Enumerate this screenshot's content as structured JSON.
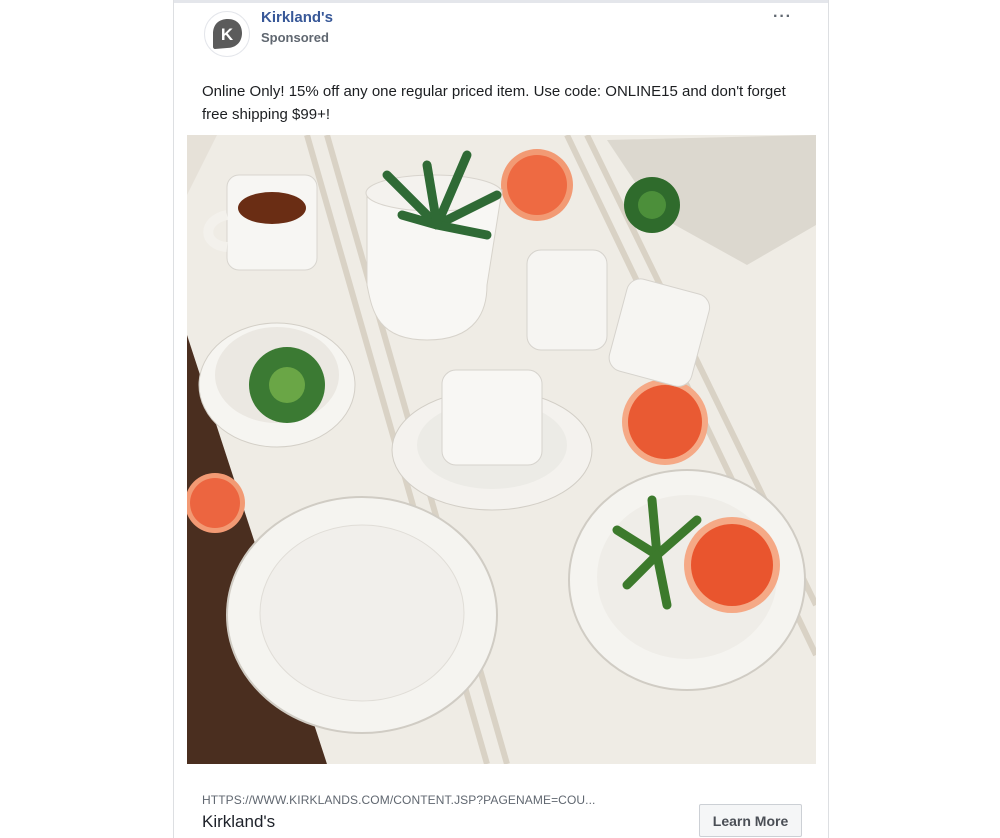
{
  "post": {
    "page_name": "Kirkland's",
    "sponsored_label": "Sponsored",
    "more_options": "···",
    "avatar_letter": "K",
    "text": "Online Only! 15% off any one regular priced item. Use code: ONLINE15 and don't forget free shipping $99+!"
  },
  "link": {
    "url": "HTTPS://WWW.KIRKLANDS.COM/CONTENT.JSP?PAGENAME=COU...",
    "title": "Kirkland's",
    "cta_label": "Learn More"
  },
  "colors": {
    "page_name": "#385898",
    "avatar_bg": "#5b5b5b",
    "cta_bg": "#f5f6f7"
  }
}
